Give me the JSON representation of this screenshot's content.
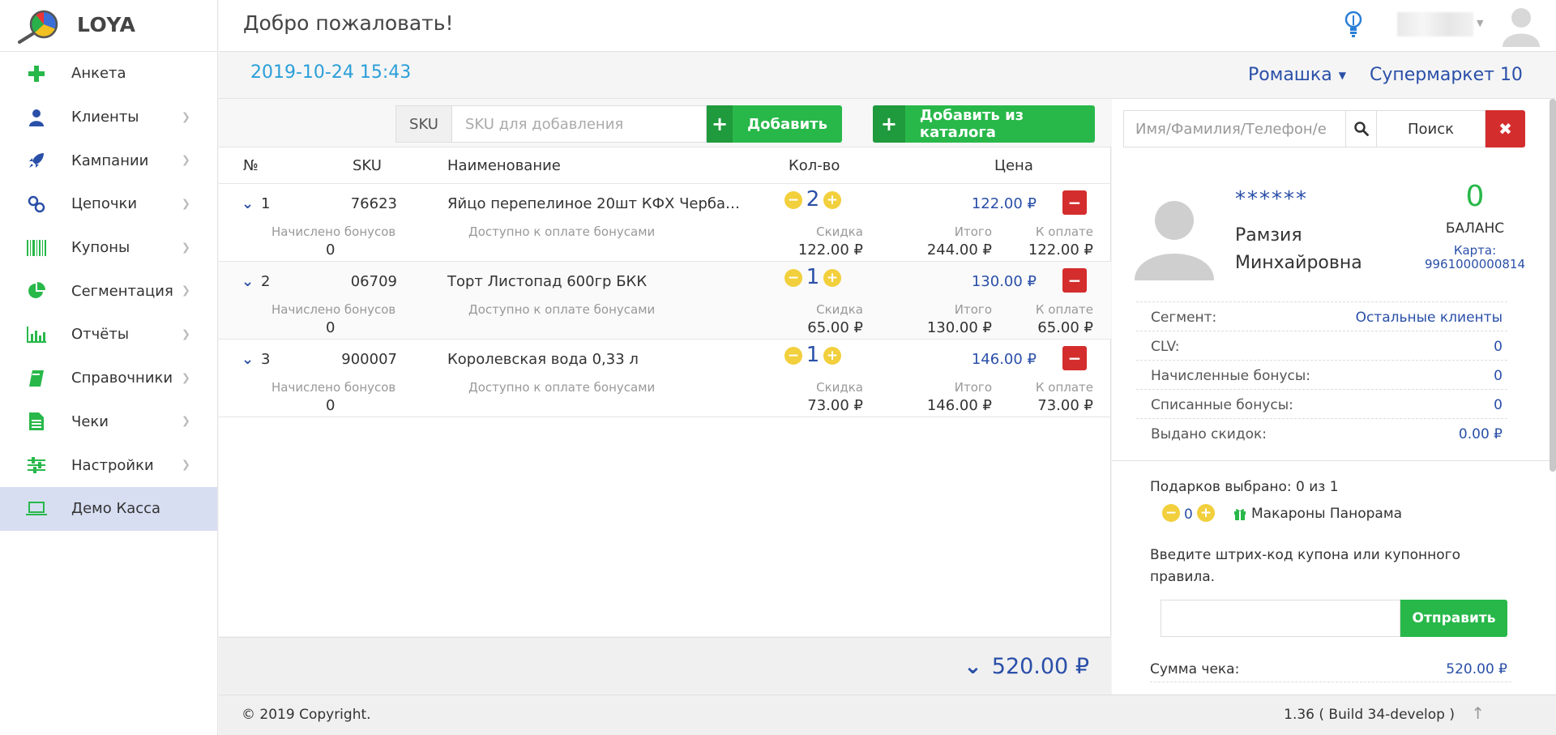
{
  "app": {
    "name": "LOYA"
  },
  "sidebar": {
    "items": [
      {
        "label": "Анкета",
        "icon": "plus-icon",
        "has_chevron": false
      },
      {
        "label": "Клиенты",
        "icon": "user-icon",
        "has_chevron": true
      },
      {
        "label": "Кампании",
        "icon": "rocket-icon",
        "has_chevron": true
      },
      {
        "label": "Цепочки",
        "icon": "chain-icon",
        "has_chevron": true
      },
      {
        "label": "Купоны",
        "icon": "barcode-icon",
        "has_chevron": true
      },
      {
        "label": "Сегментация",
        "icon": "pie-icon",
        "has_chevron": true
      },
      {
        "label": "Отчёты",
        "icon": "bar-chart-icon",
        "has_chevron": true
      },
      {
        "label": "Справочники",
        "icon": "book-icon",
        "has_chevron": true
      },
      {
        "label": "Чеки",
        "icon": "document-icon",
        "has_chevron": true
      },
      {
        "label": "Настройки",
        "icon": "sliders-icon",
        "has_chevron": true
      },
      {
        "label": "Демо Касса",
        "icon": "laptop-icon",
        "has_chevron": false,
        "active": true
      }
    ]
  },
  "header": {
    "title": "Добро пожаловать!"
  },
  "subbar": {
    "datetime": "2019-10-24 15:43",
    "store": "Ромашка",
    "shop": "Супермаркет 10"
  },
  "toolbar": {
    "sku_addon": "SKU",
    "sku_placeholder": "SKU для добавления",
    "add_label": "Добавить",
    "add_catalog_label": "Добавить из каталога"
  },
  "table": {
    "headers": {
      "num": "№",
      "sku": "SKU",
      "name": "Наименование",
      "qty": "Кол-во",
      "price": "Цена"
    },
    "detail_labels": {
      "bonus": "Начислено бонусов",
      "pay_bonus": "Доступно к оплате бонусами",
      "discount": "Скидка",
      "total": "Итого",
      "to_pay": "К оплате"
    },
    "rows": [
      {
        "num": "1",
        "sku": "76623",
        "name": "Яйцо перепелиное 20шт КФХ Чербаев КФХ",
        "qty": "2",
        "price": "122.00 ₽",
        "bonus": "0",
        "discount": "122.00 ₽",
        "total": "244.00 ₽",
        "to_pay": "122.00 ₽"
      },
      {
        "num": "2",
        "sku": "06709",
        "name": "Торт Листопад 600гр БКК",
        "qty": "1",
        "price": "130.00 ₽",
        "bonus": "0",
        "discount": "65.00 ₽",
        "total": "130.00 ₽",
        "to_pay": "65.00 ₽"
      },
      {
        "num": "3",
        "sku": "900007",
        "name": "Королевская вода 0,33 л",
        "qty": "1",
        "price": "146.00 ₽",
        "bonus": "0",
        "discount": "73.00 ₽",
        "total": "146.00 ₽",
        "to_pay": "73.00 ₽"
      }
    ],
    "grand_total": "520.00 ₽"
  },
  "client": {
    "search_placeholder": "Имя/Фамилия/Телефон/е",
    "search_label": "Поиск",
    "masked": "******",
    "name": "Рамзия Минхайровна",
    "balance": "0",
    "balance_label": "БАЛАНС",
    "card_label": "Карта:",
    "card": "9961000000814",
    "stats": [
      {
        "key": "Сегмент:",
        "value": "Остальные клиенты"
      },
      {
        "key": "CLV:",
        "value": "0"
      },
      {
        "key": "Начисленные бонусы:",
        "value": "0"
      },
      {
        "key": "Списанные бонусы:",
        "value": "0"
      },
      {
        "key": "Выдано скидок:",
        "value": "0.00 ₽"
      }
    ],
    "gifts_title": "Подарков выбрано: 0 из 1",
    "gift_count": "0",
    "gift_name": "Макароны Панорама",
    "coupon_prompt": "Введите штрих-код купона или купонного правила.",
    "send_label": "Отправить",
    "sum_label": "Сумма чека:",
    "sum_value": "520.00 ₽"
  },
  "footer": {
    "copyright": "© 2019 Copyright.",
    "version": "1.36 ( Build 34-develop )"
  },
  "colors": {
    "accent_blue": "#2a4fa8",
    "green": "#28b84a",
    "red": "#d42d2d",
    "yellow": "#f2cf3c",
    "sky": "#2a9fd8"
  }
}
